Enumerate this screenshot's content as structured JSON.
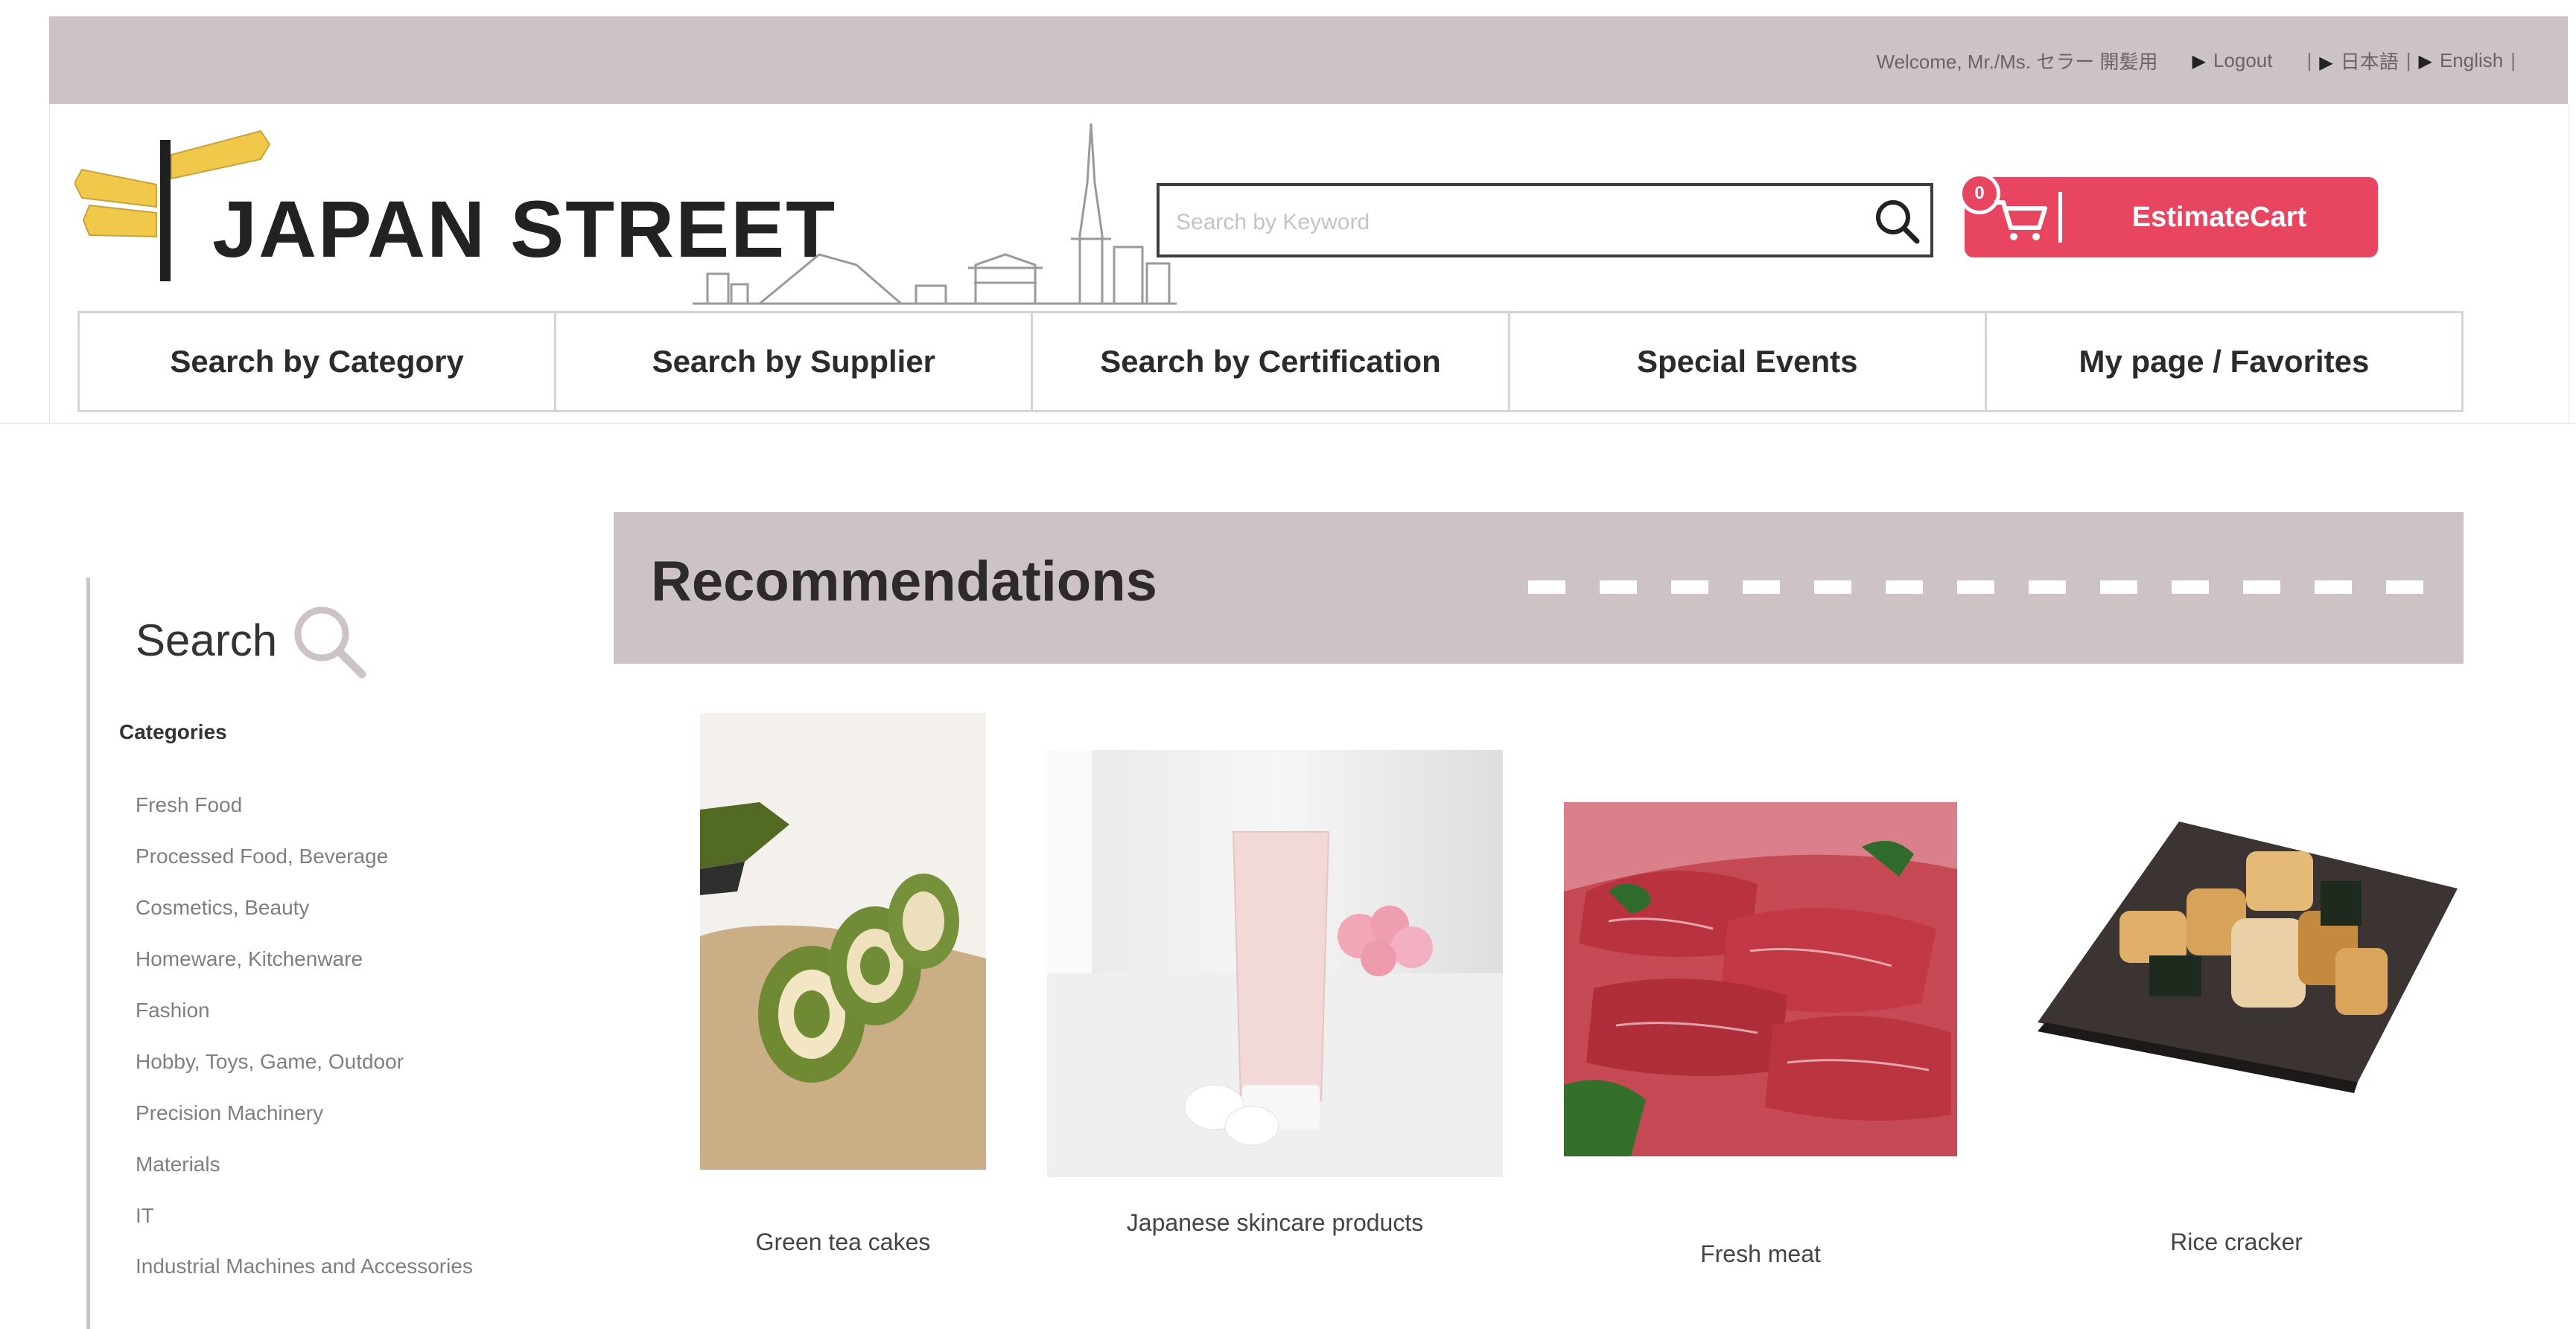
{
  "topbar": {
    "welcome": "Welcome, Mr./Ms. セラー 開髪用",
    "logout": "Logout",
    "lang_ja": "日本語",
    "lang_en": "English"
  },
  "header": {
    "logo_text": "JAPAN STREET",
    "search_placeholder": "Search by Keyword",
    "cart_count": "0",
    "cart_label": "EstimateCart"
  },
  "nav": {
    "items": [
      "Search by Category",
      "Search by  Supplier",
      "Search by Certification",
      "Special Events",
      "My page / Favorites"
    ]
  },
  "sidebar": {
    "title": "Search",
    "categories_heading": "Categories",
    "categories": [
      "Fresh Food",
      "Processed Food, Beverage",
      "Cosmetics, Beauty",
      "Homeware, Kitchenware",
      "Fashion",
      "Hobby, Toys, Game, Outdoor",
      "Precision Machinery",
      "Materials",
      "IT",
      "Industrial Machines and Accessories"
    ]
  },
  "recommendations": {
    "title": "Recommendations",
    "products": [
      {
        "label": "Green tea cakes"
      },
      {
        "label": "Japanese skincare products"
      },
      {
        "label": "Fresh meat"
      },
      {
        "label": "Rice cracker"
      }
    ]
  },
  "colors": {
    "band": "#cdc3c4",
    "cart": "#e84560",
    "text_dark": "#2b2b2b"
  }
}
